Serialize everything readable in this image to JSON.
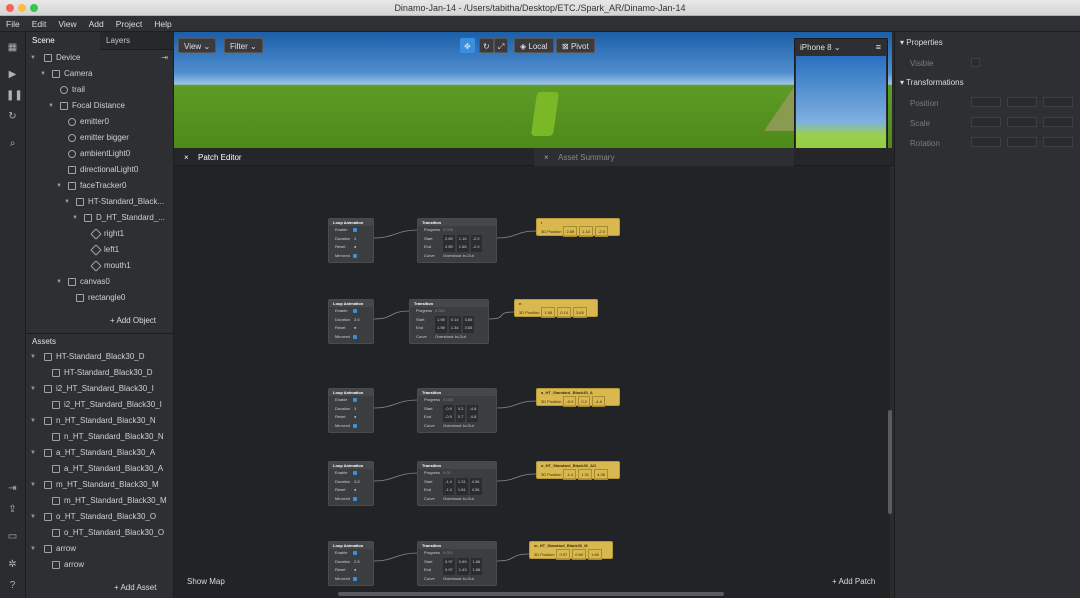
{
  "window": {
    "title": "Dinamo-Jan-14 - /Users/tabitha/Desktop/ETC./Spark_AR/Dinamo-Jan-14"
  },
  "menu": [
    "File",
    "Edit",
    "View",
    "Add",
    "Project",
    "Help"
  ],
  "scene_panel": {
    "tabs": [
      "Scene",
      "Layers"
    ],
    "tree": [
      {
        "label": "Device"
      },
      {
        "label": "Camera"
      },
      {
        "label": "trail"
      },
      {
        "label": "Focal Distance"
      },
      {
        "label": "emitter0"
      },
      {
        "label": "emitter bigger"
      },
      {
        "label": "ambientLight0"
      },
      {
        "label": "directionalLight0"
      },
      {
        "label": "faceTracker0"
      },
      {
        "label": "HT-Standard_Black..."
      },
      {
        "label": "D_HT_Standard_..."
      },
      {
        "label": "right1"
      },
      {
        "label": "left1"
      },
      {
        "label": "mouth1"
      },
      {
        "label": "canvas0"
      },
      {
        "label": "rectangle0"
      }
    ],
    "add_object": "Add Object",
    "assets_title": "Assets",
    "assets": [
      {
        "label": "HT-Standard_Black30_D"
      },
      {
        "label": "HT-Standard_Black30_D"
      },
      {
        "label": "i2_HT_Standard_Black30_I"
      },
      {
        "label": "i2_HT_Standard_Black30_I"
      },
      {
        "label": "n_HT_Standard_Black30_N"
      },
      {
        "label": "n_HT_Standard_Black30_N"
      },
      {
        "label": "a_HT_Standard_Black30_A"
      },
      {
        "label": "a_HT_Standard_Black30_A"
      },
      {
        "label": "m_HT_Standard_Black30_M"
      },
      {
        "label": "m_HT_Standard_Black30_M"
      },
      {
        "label": "o_HT_Standard_Black30_O"
      },
      {
        "label": "o_HT_Standard_Black30_O"
      },
      {
        "label": "arrow"
      },
      {
        "label": "arrow"
      }
    ],
    "add_asset": "Add Asset"
  },
  "viewport": {
    "view": "View",
    "filter": "Filter",
    "local": "Local",
    "pivot": "Pivot"
  },
  "patch_editor": {
    "title": "Patch Editor",
    "asset_summary": "Asset Summary",
    "show_map": "Show Map",
    "add_patch": "Add Patch",
    "loop_title": "Loop Animation",
    "loop_rows": [
      "Enable",
      "Duration",
      "Reset",
      "Mirrored"
    ],
    "trans_title": "Transition",
    "trans_rows": [
      "Progress",
      "Start",
      "End",
      "Curve"
    ],
    "curve": "Overshoot In-Out",
    "position_label": "3D Position",
    "groups": [
      {
        "duration": "4",
        "progress": "0.036",
        "start": [
          "2.89",
          "1.16",
          "-2.0"
        ],
        "end": [
          "2.89",
          "1.66",
          "-2.0"
        ],
        "target": "i",
        "pos": [
          "2.89",
          "1.16",
          "-2.0"
        ]
      },
      {
        "duration": "3.5",
        "progress": "0.041",
        "start": [
          "1.98",
          "0.14",
          "3.65"
        ],
        "end": [
          "1.98",
          "1.34",
          "3.65"
        ],
        "target": "n",
        "pos": [
          "1.98",
          "0.14",
          "3.65"
        ]
      },
      {
        "duration": "3",
        "progress": "0.023",
        "start": [
          "-0.9",
          "0.2",
          "-4.8"
        ],
        "end": [
          "-0.9",
          "0.7",
          "-4.8"
        ],
        "target": "a_HT_Standard_Black30_A",
        "pos": [
          "-0.9",
          "0.2",
          "-4.8"
        ]
      },
      {
        "duration": "3.8",
        "progress": "0.02",
        "start": [
          "-1.4",
          "1.31",
          "4.36"
        ],
        "end": [
          "-1.4",
          "1.81",
          "4.36"
        ],
        "target": "o_HT_Standard_Black30_AO",
        "pos": [
          "-1.4",
          "1.31",
          "4.36"
        ]
      },
      {
        "duration": "2.8",
        "progress": "0.021",
        "start": [
          "0.97",
          "0.69",
          "1.86"
        ],
        "end": [
          "0.97",
          "1.43",
          "1.86"
        ],
        "target": "m_HT_Standard_Black30_M",
        "pos": [
          "0.97",
          "0.69",
          "1.86"
        ]
      }
    ]
  },
  "preview": {
    "device": "iPhone 8"
  },
  "properties": {
    "title": "Properties",
    "visible": "Visible",
    "transformations": "Transformations",
    "rows": [
      "Position",
      "Scale",
      "Rotation"
    ]
  },
  "colors": {
    "accent": "#3b8fe0",
    "patch_yellow": "#d8b84f",
    "node_bg": "#3c3d40",
    "panel_bg": "#2e2f32"
  }
}
